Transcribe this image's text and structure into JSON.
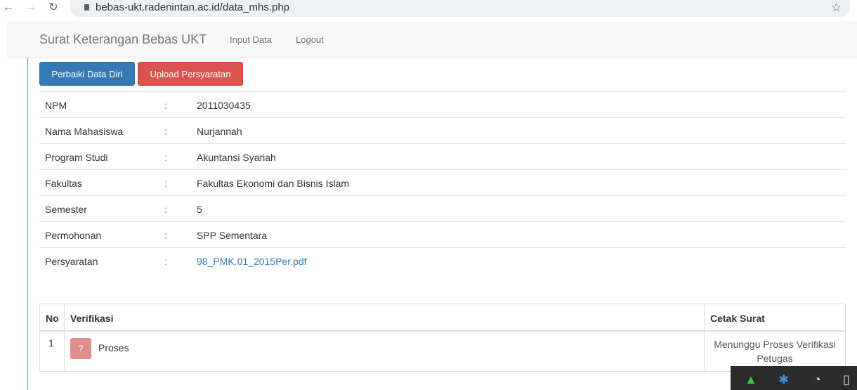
{
  "browser": {
    "url": "bebas-ukt.radenintan.ac.id/data_mhs.php",
    "back_glyph": "←",
    "forward_glyph": "→",
    "reload_glyph": "↻",
    "star_glyph": "☆"
  },
  "navbar": {
    "brand": "Surat Keterangan Bebas UKT",
    "links": [
      "Input Data",
      "Logout"
    ]
  },
  "actions": {
    "fix_data_label": "Perbaiki Data Diri",
    "upload_label": "Upload Persyaratan"
  },
  "student": {
    "colon": ":",
    "rows": [
      {
        "label": "NPM",
        "value": "2011030435"
      },
      {
        "label": "Nama Mahasiswa",
        "value": "Nurjannah"
      },
      {
        "label": "Program Studi",
        "value": "Akuntansi Syariah"
      },
      {
        "label": "Fakultas",
        "value": "Fakultas Ekonomi dan Bisnis Islam"
      },
      {
        "label": "Semester",
        "value": "5"
      },
      {
        "label": "Permohonan",
        "value": "SPP Sementara"
      },
      {
        "label": "Persyaratan",
        "value": "98_PMK.01_2015Per.pdf"
      }
    ]
  },
  "verification": {
    "headers": {
      "no": "No",
      "verifikasi": "Verifikasi",
      "cetak": "Cetak Surat"
    },
    "row": {
      "no": "1",
      "badge": "?",
      "status": "Proses",
      "cetak_line1": "Menunggu Proses Verifikasi",
      "cetak_line2": "Petugas"
    }
  },
  "colors": {
    "primary": "#337ab7",
    "danger": "#d9534f",
    "link": "#337ab7"
  }
}
